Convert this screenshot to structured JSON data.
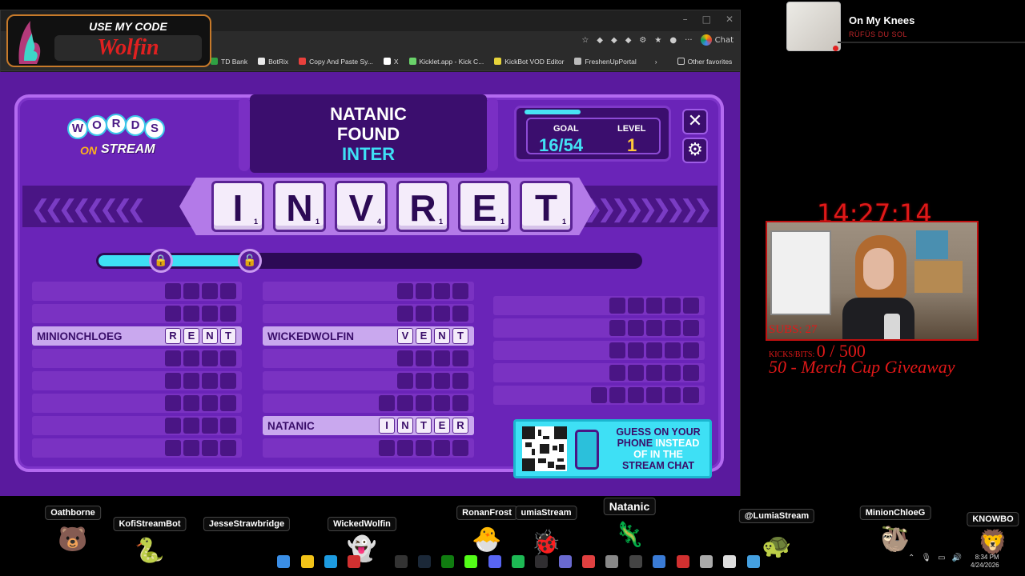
{
  "browser": {
    "bookmarks": [
      "TD Bank",
      "BotRix",
      "Copy And Paste Sy...",
      "X",
      "Kicklet.app - Kick C...",
      "KickBot VOD Editor",
      "FreshenUpPortal"
    ],
    "other_favorites": "Other favorites",
    "chat_label": "Chat",
    "chevron": "›"
  },
  "code_overlay": {
    "title": "USE MY CODE",
    "code": "Wolfin"
  },
  "game": {
    "logo": {
      "words": [
        "W",
        "O",
        "R",
        "D",
        "S"
      ],
      "on": "ON",
      "stream": "STREAM"
    },
    "found": {
      "player": "NATANIC",
      "verb": "FOUND",
      "word": "INTER"
    },
    "goal": {
      "label": "GOAL",
      "value": "16/54"
    },
    "level": {
      "label": "LEVEL",
      "value": "1"
    },
    "close_label": "✕",
    "settings_label": "⚙",
    "letters": [
      {
        "ch": "I",
        "pts": "1"
      },
      {
        "ch": "N",
        "pts": "1"
      },
      {
        "ch": "V",
        "pts": "4"
      },
      {
        "ch": "R",
        "pts": "1"
      },
      {
        "ch": "E",
        "pts": "1"
      },
      {
        "ch": "T",
        "pts": "1"
      }
    ],
    "progress_fraction": 0.28,
    "columns": [
      [
        {
          "name": "",
          "len": 4,
          "letters": []
        },
        {
          "name": "",
          "len": 4,
          "letters": []
        },
        {
          "name": "MINIONCHLOEG",
          "len": 4,
          "letters": [
            "R",
            "E",
            "N",
            "T"
          ]
        },
        {
          "name": "",
          "len": 4,
          "letters": []
        },
        {
          "name": "",
          "len": 4,
          "letters": []
        },
        {
          "name": "",
          "len": 4,
          "letters": []
        },
        {
          "name": "",
          "len": 4,
          "letters": []
        },
        {
          "name": "",
          "len": 4,
          "letters": []
        }
      ],
      [
        {
          "name": "",
          "len": 4,
          "letters": []
        },
        {
          "name": "",
          "len": 4,
          "letters": []
        },
        {
          "name": "WICKEDWOLFIN",
          "len": 4,
          "letters": [
            "V",
            "E",
            "N",
            "T"
          ]
        },
        {
          "name": "",
          "len": 4,
          "letters": []
        },
        {
          "name": "",
          "len": 4,
          "letters": []
        },
        {
          "name": "",
          "len": 5,
          "letters": []
        },
        {
          "name": "NATANIC",
          "len": 5,
          "letters": [
            "I",
            "N",
            "T",
            "E",
            "R"
          ]
        },
        {
          "name": "",
          "len": 5,
          "letters": []
        }
      ],
      [
        {
          "name": "",
          "len": 5,
          "letters": []
        },
        {
          "name": "",
          "len": 5,
          "letters": []
        },
        {
          "name": "",
          "len": 5,
          "letters": []
        },
        {
          "name": "",
          "len": 5,
          "letters": []
        },
        {
          "name": "",
          "len": 6,
          "letters": []
        }
      ]
    ],
    "qr_promo": {
      "line1": "GUESS ON YOUR",
      "line2": "PHONE",
      "line2b": "INSTEAD",
      "line3": "OF IN THE",
      "line4": "STREAM CHAT"
    }
  },
  "now_playing": {
    "title": "On My Knees",
    "artist": "RÜFÜS DU SOL"
  },
  "stream": {
    "clock": "14:27:14",
    "subs": "SUBS: 27",
    "kicks_label": "KICKS/BITS:",
    "kicks_value": "0 / 500",
    "goal_text": "50 - Merch Cup Giveaway"
  },
  "chatters": [
    {
      "name": "Oathborne",
      "icon": "🐻"
    },
    {
      "name": "KofiStreamBot",
      "icon": "🐍"
    },
    {
      "name": "JesseStrawbridge",
      "icon": "🐵"
    },
    {
      "name": "WickedWolfin",
      "icon": "👻"
    },
    {
      "name": "RonanFrost",
      "icon": "🐣"
    },
    {
      "name": "umiaStream",
      "icon": "🐞"
    },
    {
      "name": "Natanic",
      "icon": "🦎"
    },
    {
      "name": "@LumiaStream",
      "icon": "🐢"
    },
    {
      "name": "MinionChloeG",
      "icon": "🦥"
    },
    {
      "name": "KNOWBO",
      "icon": "🦁"
    }
  ],
  "taskbar": {
    "time": "8:34 PM",
    "date": "4/24/2026"
  }
}
